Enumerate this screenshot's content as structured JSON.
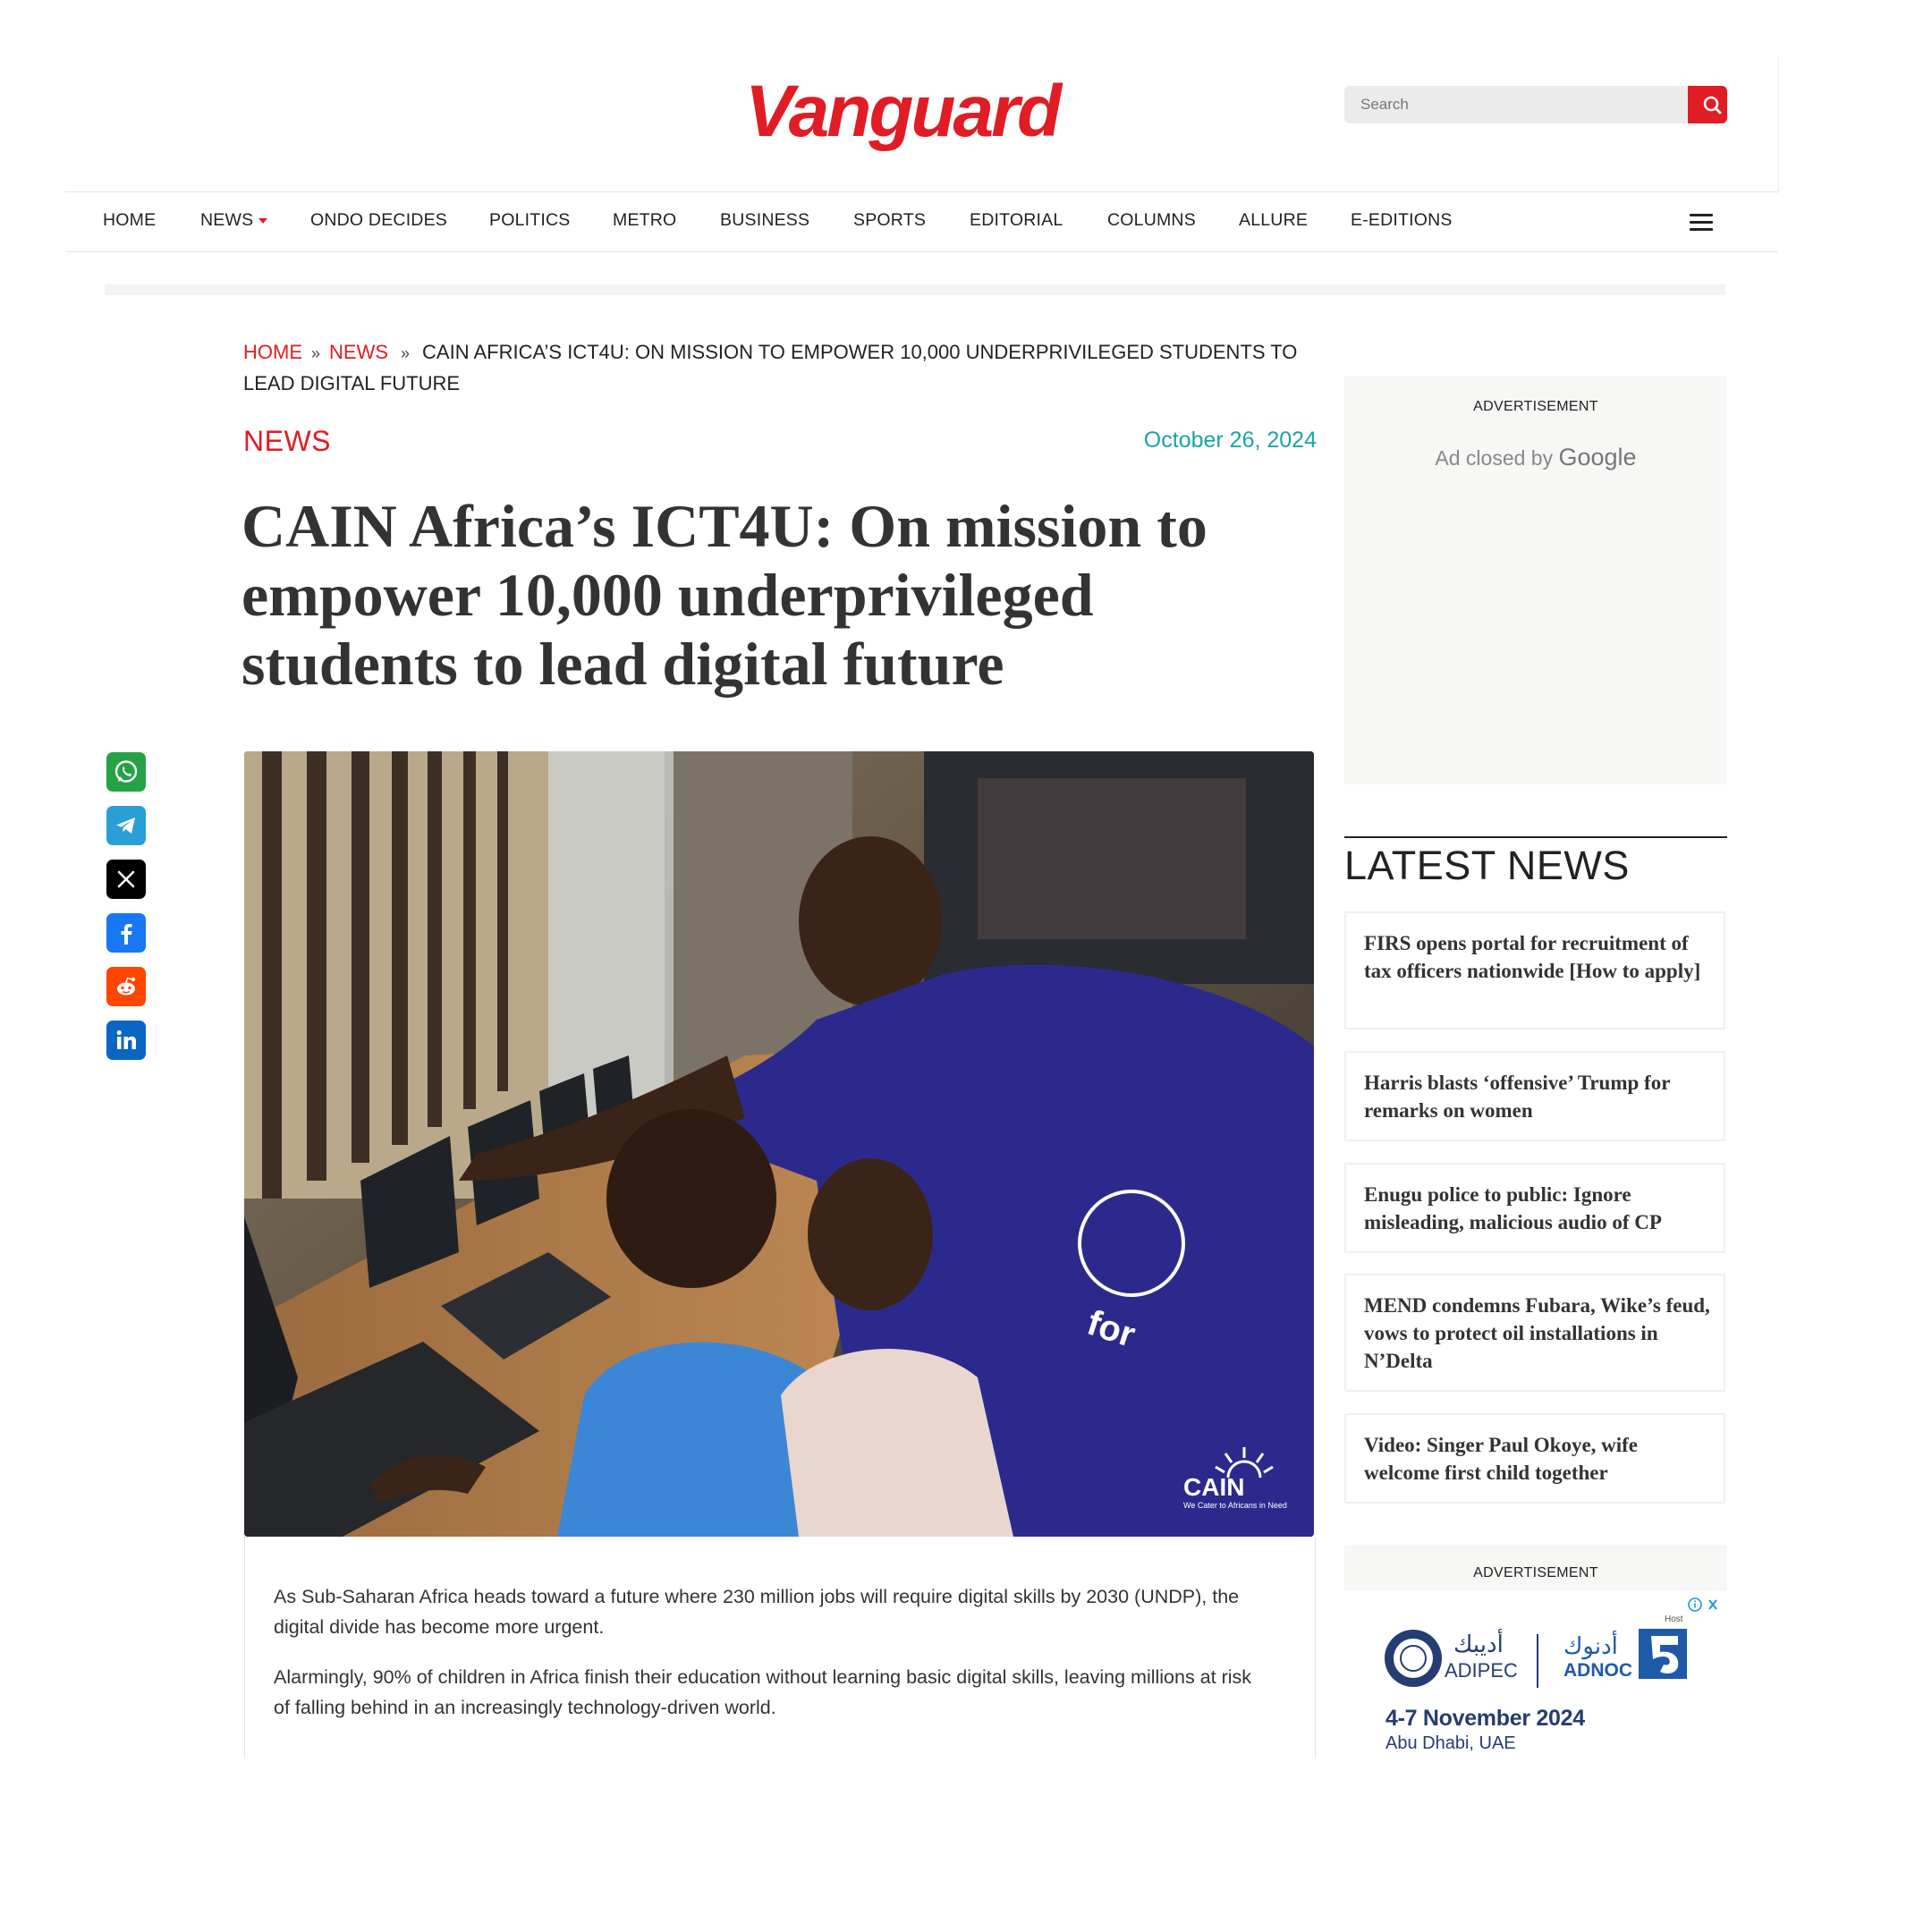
{
  "site": {
    "logo_text": "Vanguard",
    "brand_color": "#e01c24"
  },
  "search": {
    "placeholder": "Search"
  },
  "nav": {
    "items": [
      "HOME",
      "NEWS",
      "ONDO DECIDES",
      "POLITICS",
      "METRO",
      "BUSINESS",
      "SPORTS",
      "EDITORIAL",
      "COLUMNS",
      "ALLURE",
      "E-EDITIONS"
    ]
  },
  "breadcrumb": {
    "home": "HOME",
    "sep1": "»",
    "news": "NEWS",
    "sep2": "»",
    "current": "CAIN AFRICA’S ICT4U: ON MISSION TO EMPOWER 10,000 UNDERPRIVILEGED STUDENTS TO LEAD DIGITAL FUTURE"
  },
  "article": {
    "category": "NEWS",
    "date": "October 26, 2024",
    "headline": "CAIN Africa’s ICT4U: On mission to empower 10,000 underprivileged students to lead digital future",
    "image_logo": "CAIN",
    "image_logo_tagline": "We Cater to Africans in Need",
    "shirt_text": "for",
    "paragraphs": [
      "As Sub-Saharan Africa heads toward a future where 230 million jobs will require digital skills by 2030 (UNDP), the digital divide has become more urgent.",
      "Alarmingly, 90% of children in Africa finish their education without learning basic digital skills, leaving millions at risk of falling behind in an increasingly technology-driven world."
    ]
  },
  "share": {
    "icons": [
      "whatsapp-icon",
      "telegram-icon",
      "x-icon",
      "facebook-icon",
      "reddit-icon",
      "linkedin-icon"
    ],
    "colors": {
      "whatsapp": "#25a244",
      "telegram": "#2a9fd6",
      "x": "#000000",
      "facebook": "#1877f2",
      "reddit": "#ff4500",
      "linkedin": "#0a66c2"
    }
  },
  "sidebar": {
    "ad1": {
      "label": "ADVERTISEMENT",
      "closed_text": "Ad closed by",
      "closed_brand": "Google"
    },
    "latest_title": "LATEST NEWS",
    "latest": [
      "FIRS opens portal for recruitment of tax officers nationwide [How to apply]",
      "Harris blasts ‘offensive’ Trump for remarks on women",
      "Enugu police to public: Ignore misleading,  malicious audio of CP",
      "MEND condemns Fubara, Wike’s feud, vows to protect oil installations in N’Delta",
      "Video: Singer Paul Okoye, wife welcome first child together"
    ],
    "ad2": {
      "label": "ADVERTISEMENT",
      "adipec_ar": "أديبك",
      "adipec": "ADIPEC",
      "adnoc_ar": "أدنوك",
      "adnoc": "ADNOC",
      "host": "Host",
      "dates": "4-7 November 2024",
      "location": "Abu Dhabi, UAE"
    }
  }
}
